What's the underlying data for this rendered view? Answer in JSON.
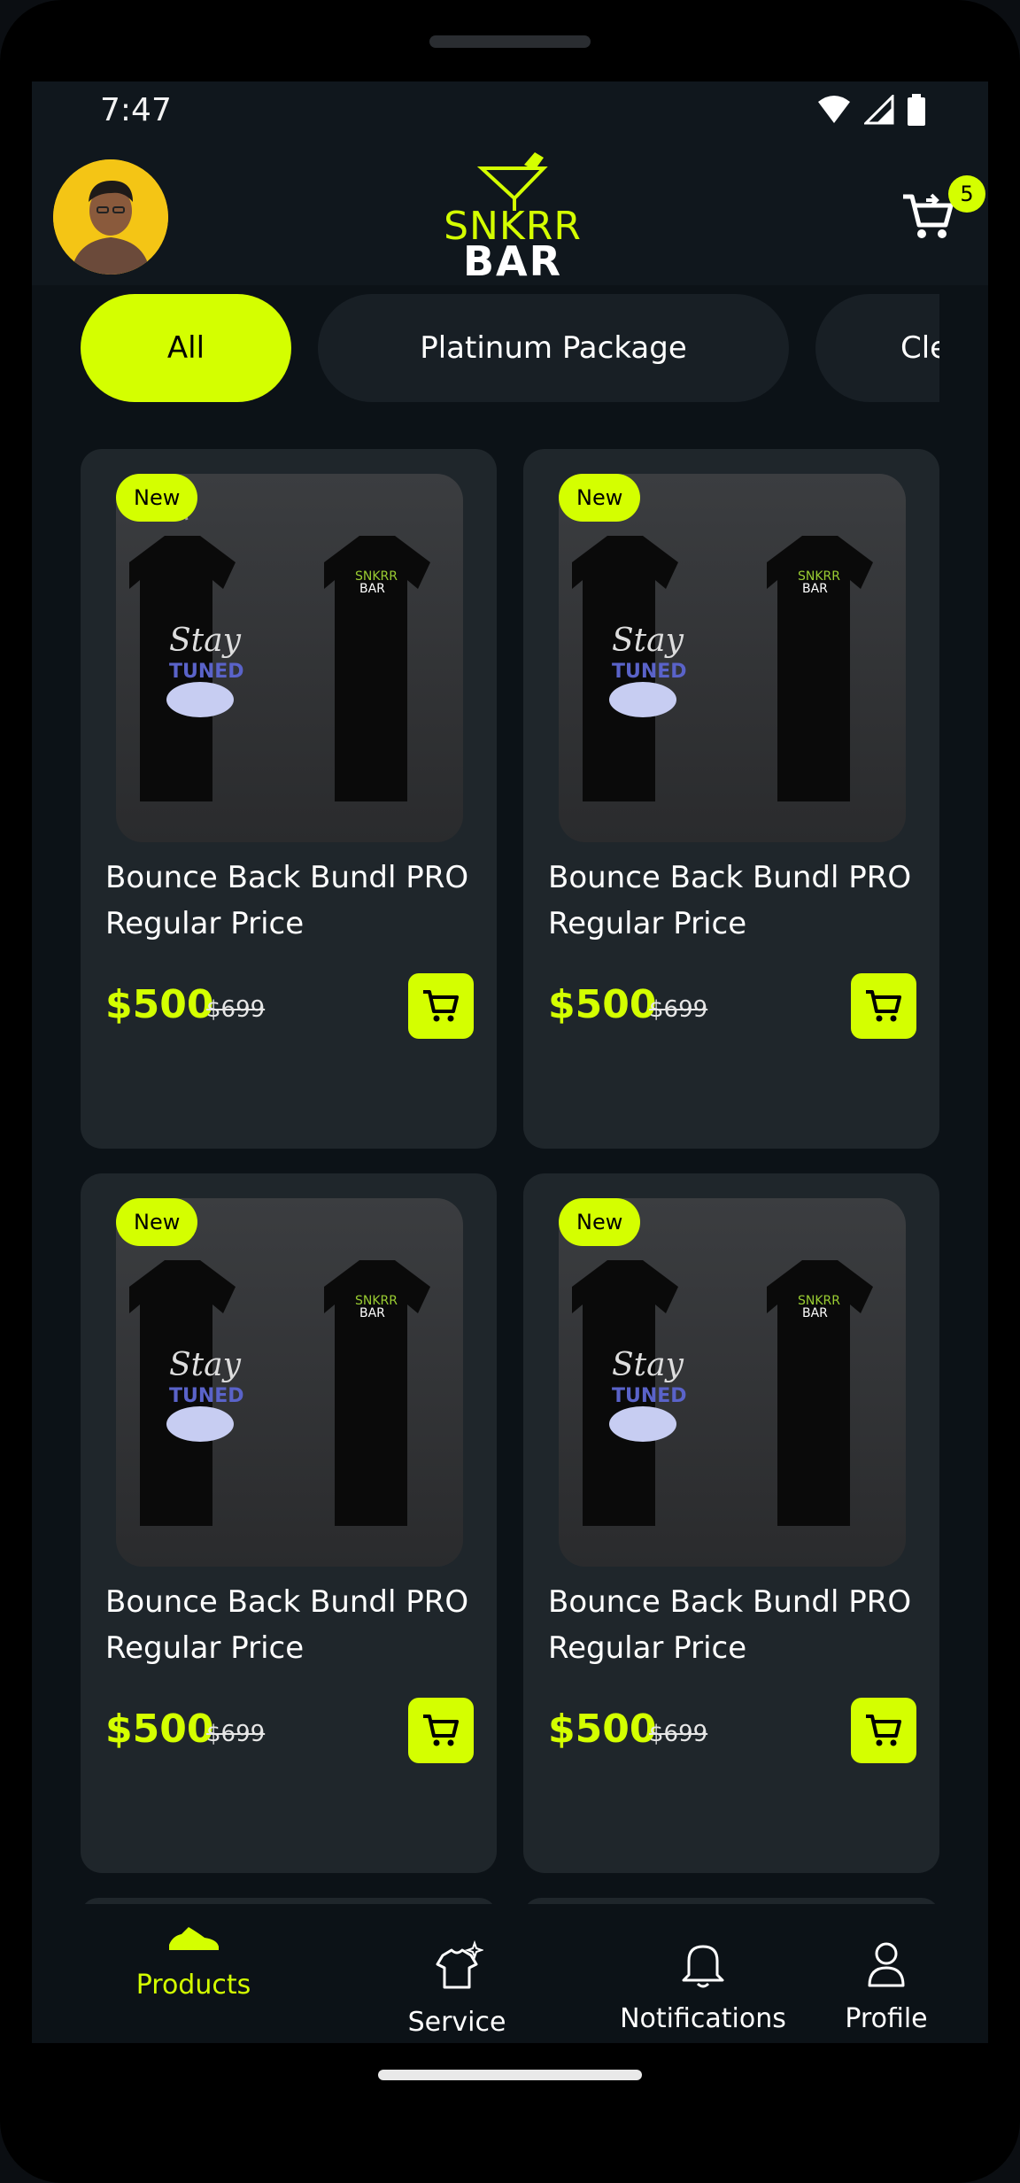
{
  "status": {
    "time": "7:47"
  },
  "header": {
    "logo_top": "SNKRR",
    "logo_bottom": "BAR",
    "cart_count": "5"
  },
  "chips": [
    {
      "label": "All",
      "active": true
    },
    {
      "label": "Platinum Package"
    },
    {
      "label": "Cle"
    }
  ],
  "products": [
    {
      "badge": "New",
      "title": "Bounce Back Bundl PRO Regular Price",
      "price": "$500",
      "old_price": "$699"
    },
    {
      "badge": "New",
      "title": "Bounce Back Bundl PRO Regular Price",
      "price": "$500",
      "old_price": "$699"
    },
    {
      "badge": "New",
      "title": "Bounce Back Bundl PRO Regular Price",
      "price": "$500",
      "old_price": "$699"
    },
    {
      "badge": "New",
      "title": "Bounce Back Bundl PRO Regular Price",
      "price": "$500",
      "old_price": "$699"
    }
  ],
  "nav": {
    "products": "Products",
    "service": "Service",
    "notifications": "Notifications",
    "profile": "Profile"
  },
  "colors": {
    "accent": "#d4ff00",
    "background": "#0c1217",
    "card": "#1f262b"
  }
}
